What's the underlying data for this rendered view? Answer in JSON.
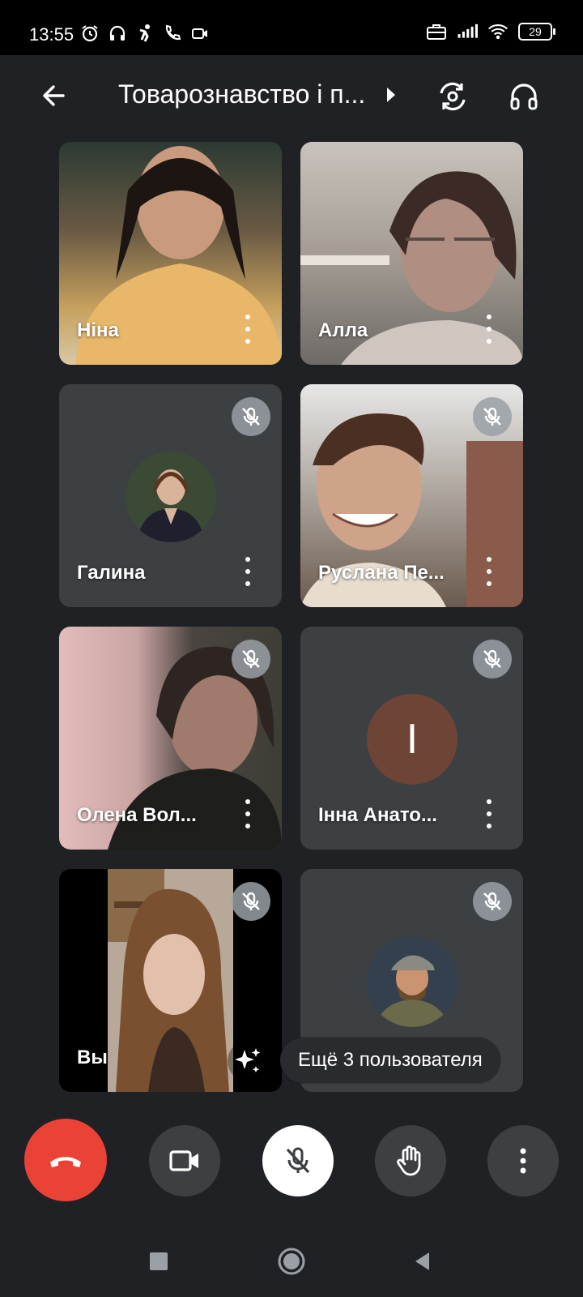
{
  "status_bar": {
    "time": "13:55",
    "battery": "29",
    "left_icons": [
      "alarm-icon",
      "headphones-icon",
      "figure-icon",
      "phone-icon",
      "video-icon"
    ],
    "right_icons": [
      "briefcase-icon",
      "signal-icon",
      "wifi-icon",
      "battery-icon"
    ]
  },
  "header": {
    "title": "Товарознавство і п...",
    "back_icon": "arrow-left-icon",
    "switch_camera_icon": "switch-camera-icon",
    "audio_icon": "headphones-icon"
  },
  "participants": [
    {
      "name": "Ніна",
      "muted": false,
      "media": "video"
    },
    {
      "name": "Алла",
      "muted": false,
      "media": "video"
    },
    {
      "name": "Галина",
      "muted": true,
      "media": "photo-avatar"
    },
    {
      "name": "Руслана Пе...",
      "muted": true,
      "media": "video"
    },
    {
      "name": "Олена Вол...",
      "muted": true,
      "media": "video"
    },
    {
      "name": "Інна Анато...",
      "muted": true,
      "media": "letter-avatar",
      "initial": "І",
      "avatar_color": "#6d4435"
    },
    {
      "name": "Вы",
      "muted": true,
      "media": "video"
    },
    {
      "name": "",
      "muted": true,
      "media": "photo-avatar"
    }
  ],
  "more_users": "Ещё 3 пользователя",
  "controls": {
    "end_call_icon": "hang-up-icon",
    "camera_icon": "video-camera-icon",
    "mic_icon": "mic-off-icon",
    "raise_hand_icon": "hand-icon",
    "more_icon": "more-vertical-icon",
    "end_call_color": "#ea4335"
  },
  "nav": [
    "recents-icon",
    "home-icon",
    "back-icon"
  ]
}
